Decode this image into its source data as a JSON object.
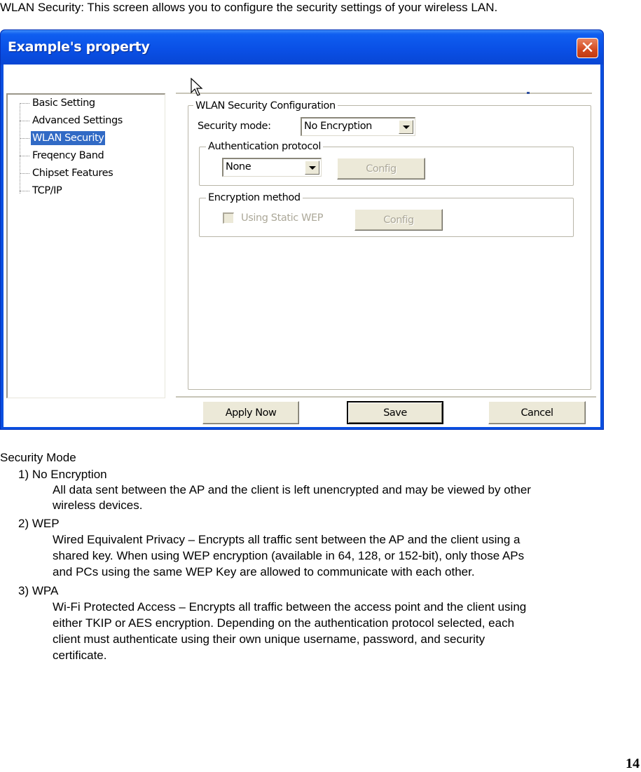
{
  "intro": "WLAN Security: This screen allows you to configure the security settings of your wireless LAN.",
  "window": {
    "title": "Example's property",
    "close_icon": "close-icon"
  },
  "tree": {
    "items": [
      {
        "label": "Basic Setting",
        "selected": false
      },
      {
        "label": "Advanced Settings",
        "selected": false
      },
      {
        "label": "WLAN Security",
        "selected": true
      },
      {
        "label": "Freqency Band",
        "selected": false
      },
      {
        "label": "Chipset Features",
        "selected": false
      },
      {
        "label": "TCP/IP",
        "selected": false
      }
    ]
  },
  "config": {
    "group_title": "WLAN Security Configuration",
    "security_mode_label": "Security mode:",
    "security_mode_value": "No Encryption",
    "auth": {
      "group_title": "Authentication protocol",
      "value": "None",
      "config_label": "Config",
      "config_enabled": false
    },
    "encryption": {
      "group_title": "Encryption method",
      "checkbox_label": "Using Static WEP",
      "checkbox_checked": false,
      "checkbox_enabled": false,
      "config_label": "Config",
      "config_enabled": false
    }
  },
  "buttons": {
    "apply": "Apply Now",
    "save": "Save",
    "cancel": "Cancel"
  },
  "doc": {
    "heading": "Security Mode",
    "modes": [
      {
        "title": "1) No Encryption",
        "lines": [
          "All data sent between the AP and the client is left unencrypted and may be viewed by other",
          "wireless devices."
        ]
      },
      {
        "title": "2) WEP",
        "lines": [
          "Wired Equivalent Privacy – Encrypts all traffic sent between the AP and the client using a",
          "shared key. When using WEP encryption (available in 64, 128, or 152-bit), only those APs",
          "and PCs using the same WEP Key are allowed to communicate with each other."
        ]
      },
      {
        "title": "3) WPA",
        "lines": [
          "Wi-Fi Protected Access – Encrypts all traffic between the access point and the client using",
          "either TKIP or AES encryption. Depending on the authentication protocol selected, each",
          "client must authenticate using their own unique username, password, and security",
          "certificate."
        ]
      }
    ]
  },
  "page_number": "14"
}
